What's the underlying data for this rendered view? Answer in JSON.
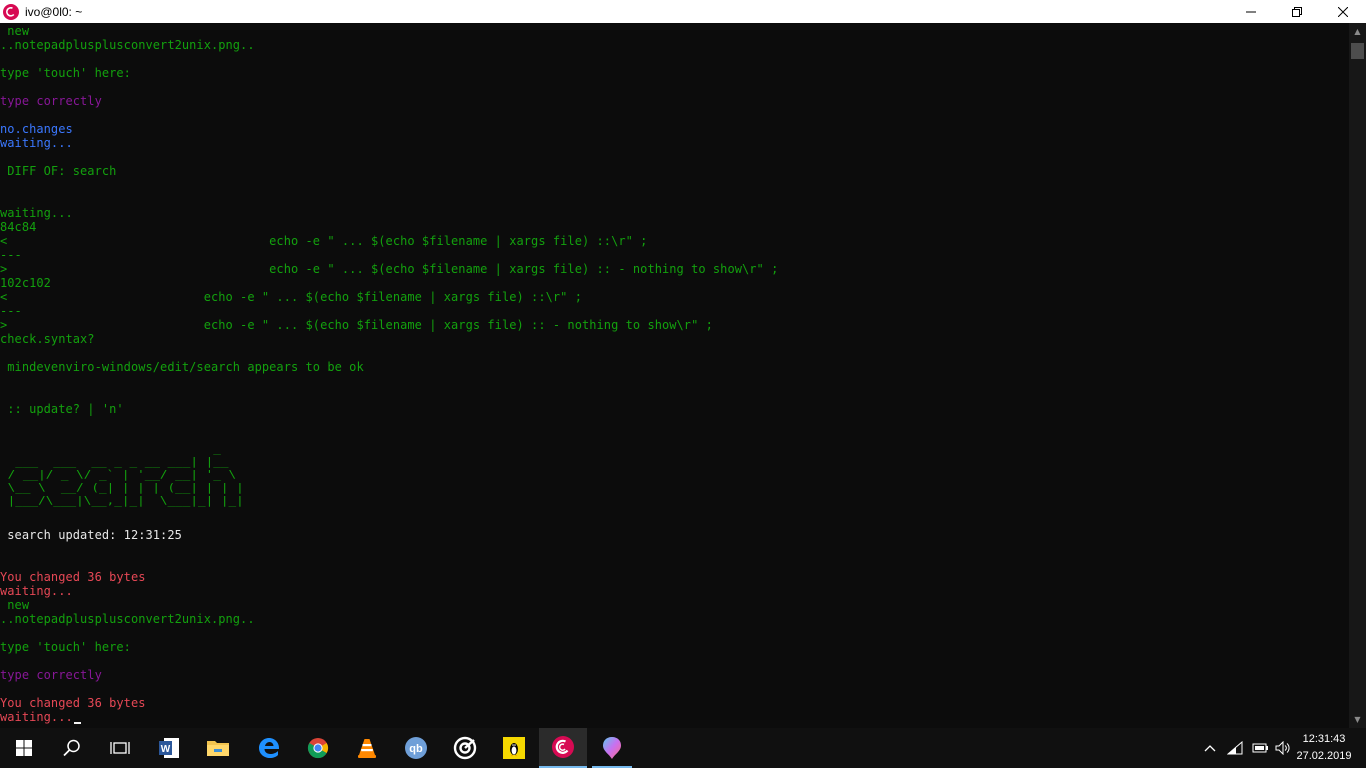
{
  "window": {
    "title": "ivo@0l0: ~",
    "minimize": "—",
    "maximize": "❐",
    "close": "✕"
  },
  "terminal": {
    "lines": [
      {
        "text": " new",
        "color": "green"
      },
      {
        "text": "..notepadplusplusconvert2unix.png..",
        "color": "green"
      },
      {
        "text": "",
        "color": "green"
      },
      {
        "text": "type 'touch' here:",
        "color": "green"
      },
      {
        "text": "",
        "color": "green"
      },
      {
        "text": "type correctly",
        "color": "magenta"
      },
      {
        "text": "",
        "color": "green"
      },
      {
        "text": "no.changes",
        "color": "blue"
      },
      {
        "text": "waiting...",
        "color": "blue"
      },
      {
        "text": "",
        "color": "green"
      },
      {
        "text": " DIFF OF: search",
        "color": "green"
      },
      {
        "text": "",
        "color": "green"
      },
      {
        "text": "",
        "color": "green"
      },
      {
        "text": "waiting...",
        "color": "green"
      },
      {
        "text": "84c84",
        "color": "green"
      },
      {
        "text": "<                                    echo -e \" ... $(echo $filename | xargs file) ::\\r\" ;",
        "color": "green"
      },
      {
        "text": "---",
        "color": "green"
      },
      {
        "text": ">                                    echo -e \" ... $(echo $filename | xargs file) :: - nothing to show\\r\" ;",
        "color": "green"
      },
      {
        "text": "102c102",
        "color": "green"
      },
      {
        "text": "<                           echo -e \" ... $(echo $filename | xargs file) ::\\r\" ;",
        "color": "green"
      },
      {
        "text": "---",
        "color": "green"
      },
      {
        "text": ">                           echo -e \" ... $(echo $filename | xargs file) :: - nothing to show\\r\" ;",
        "color": "green"
      },
      {
        "text": "check.syntax?",
        "color": "green"
      },
      {
        "text": "",
        "color": "green"
      },
      {
        "text": " mindevenviro-windows/edit/search appears to be ok",
        "color": "green"
      },
      {
        "text": "",
        "color": "green"
      },
      {
        "text": "",
        "color": "green"
      },
      {
        "text": " :: update? | 'n'",
        "color": "green"
      },
      {
        "text": "",
        "color": "green"
      },
      {
        "text": "",
        "color": "green"
      },
      {
        "text": "",
        "color": "green"
      },
      {
        "text": "",
        "color": "green"
      },
      {
        "text": "",
        "color": "green"
      },
      {
        "text": "",
        "color": "green"
      },
      {
        "text": "",
        "color": "green"
      },
      {
        "text": "",
        "color": "green"
      },
      {
        "text": " search updated: 12:31:25",
        "color": "white"
      },
      {
        "text": "",
        "color": "green"
      },
      {
        "text": "",
        "color": "green"
      },
      {
        "text": "You changed 36 bytes",
        "color": "red"
      },
      {
        "text": "waiting...",
        "color": "red"
      },
      {
        "text": " new",
        "color": "green"
      },
      {
        "text": "..notepadplusplusconvert2unix.png..",
        "color": "green"
      },
      {
        "text": "",
        "color": "green"
      },
      {
        "text": "type 'touch' here:",
        "color": "green"
      },
      {
        "text": "",
        "color": "green"
      },
      {
        "text": "type correctly",
        "color": "magenta"
      },
      {
        "text": "",
        "color": "green"
      },
      {
        "text": "You changed 36 bytes",
        "color": "red"
      },
      {
        "text": "waiting...",
        "color": "red",
        "cursor": true
      }
    ],
    "banner": {
      "lines": [
        "                            _  ",
        "  ___  ___  __ _ _ __ ___| |__",
        " / __|/ _ \\/ _` | '__/ __| '_ \\",
        " \\__ \\  __/ (_| | | | (__| | | |",
        " |___/\\___|\\__,_|_|  \\___|_| |_|"
      ],
      "color": "#13a10e"
    }
  },
  "colors": {
    "green": "#13a10e",
    "magenta": "#881798",
    "blue": "#3b78ff",
    "red": "#e74856",
    "white": "#e8e8e8"
  },
  "taskbar": {
    "items": [
      {
        "name": "start-button",
        "icon": "windows-logo-icon"
      },
      {
        "name": "search-button",
        "icon": "search-icon"
      },
      {
        "name": "task-view-button",
        "icon": "task-view-icon"
      },
      {
        "name": "word-app",
        "icon": "word-icon"
      },
      {
        "name": "file-explorer-app",
        "icon": "folder-icon"
      },
      {
        "name": "edge-app",
        "icon": "edge-icon"
      },
      {
        "name": "chrome-app",
        "icon": "chrome-icon"
      },
      {
        "name": "vlc-app",
        "icon": "vlc-cone-icon"
      },
      {
        "name": "qbittorrent-app",
        "icon": "qbittorrent-icon"
      },
      {
        "name": "target-app",
        "icon": "ring-icon"
      },
      {
        "name": "linux-app",
        "icon": "tux-icon"
      },
      {
        "name": "debian-terminal-app",
        "icon": "debian-swirl-icon",
        "active": true
      },
      {
        "name": "paint3d-app",
        "icon": "paint-drop-icon",
        "open": true
      }
    ],
    "clock": {
      "time": "12:31:43",
      "date": "27.02.2019"
    }
  }
}
